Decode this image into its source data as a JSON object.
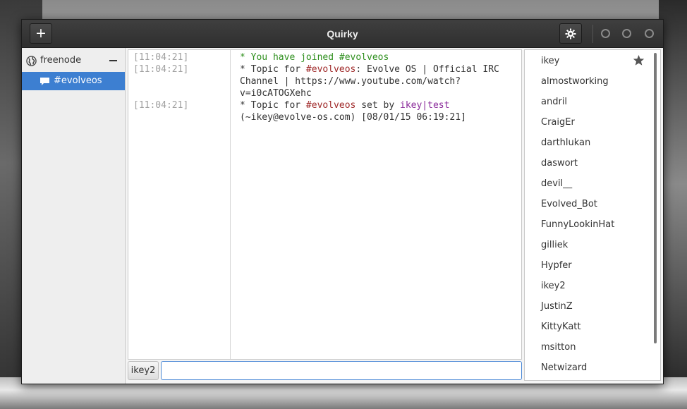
{
  "window": {
    "title": "Quirky"
  },
  "titlebar": {
    "add_label": "+",
    "add_icon": "plus-icon",
    "settings_icon": "gear-icon",
    "window_controls": [
      "minimize-icon",
      "maximize-icon",
      "close-icon"
    ]
  },
  "sidebar": {
    "server": {
      "name": "freenode",
      "icon": "globe-icon",
      "collapse_label": "−"
    },
    "channel": {
      "name": "#evolveos",
      "icon": "chat-bubble-icon"
    }
  },
  "chat": {
    "messages": [
      {
        "time": "[11:04:21]",
        "parts": [
          "* You have joined #evolveos"
        ]
      },
      {
        "time": "[11:04:21]",
        "parts": [
          "* Topic for ",
          "#evolveos",
          ": Evolve OS | Official IRC Channel | https://www.youtube.com/watch?v=i0cATOGXehc"
        ]
      },
      {
        "time": "[11:04:21]",
        "parts": [
          "* Topic for ",
          "#evolveos",
          " set by ",
          "ikey|test",
          " (~ikey@evolve-os.com) [08/01/15 06:19:21]"
        ]
      }
    ]
  },
  "input": {
    "nick": "ikey2",
    "value": ""
  },
  "users": {
    "list": [
      "ikey",
      "almostworking",
      "andril",
      "CraigEr",
      "darthlukan",
      "daswort",
      "devil__",
      "Evolved_Bot",
      "FunnyLookinHat",
      "gilliek",
      "Hypfer",
      "ikey2",
      "JustinZ",
      "KittyKatt",
      "msitton",
      "Netwizard"
    ],
    "starred_icon": "star-icon"
  },
  "colors": {
    "accent": "#3d7fd1",
    "join": "#2e8f1d",
    "channel": "#a02a2a",
    "nick": "#8a2a9a"
  }
}
